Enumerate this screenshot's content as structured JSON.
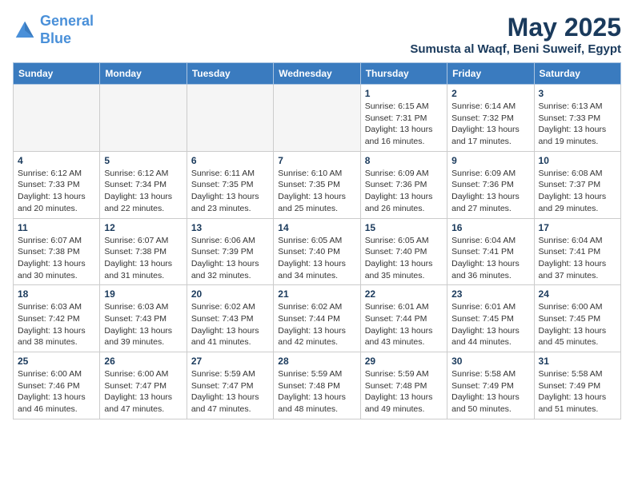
{
  "header": {
    "logo_line1": "General",
    "logo_line2": "Blue",
    "title": "May 2025",
    "subtitle": "Sumusta al Waqf, Beni Suweif, Egypt"
  },
  "weekdays": [
    "Sunday",
    "Monday",
    "Tuesday",
    "Wednesday",
    "Thursday",
    "Friday",
    "Saturday"
  ],
  "weeks": [
    [
      {
        "day": "",
        "info": ""
      },
      {
        "day": "",
        "info": ""
      },
      {
        "day": "",
        "info": ""
      },
      {
        "day": "",
        "info": ""
      },
      {
        "day": "1",
        "info": "Sunrise: 6:15 AM\nSunset: 7:31 PM\nDaylight: 13 hours and 16 minutes."
      },
      {
        "day": "2",
        "info": "Sunrise: 6:14 AM\nSunset: 7:32 PM\nDaylight: 13 hours and 17 minutes."
      },
      {
        "day": "3",
        "info": "Sunrise: 6:13 AM\nSunset: 7:33 PM\nDaylight: 13 hours and 19 minutes."
      }
    ],
    [
      {
        "day": "4",
        "info": "Sunrise: 6:12 AM\nSunset: 7:33 PM\nDaylight: 13 hours and 20 minutes."
      },
      {
        "day": "5",
        "info": "Sunrise: 6:12 AM\nSunset: 7:34 PM\nDaylight: 13 hours and 22 minutes."
      },
      {
        "day": "6",
        "info": "Sunrise: 6:11 AM\nSunset: 7:35 PM\nDaylight: 13 hours and 23 minutes."
      },
      {
        "day": "7",
        "info": "Sunrise: 6:10 AM\nSunset: 7:35 PM\nDaylight: 13 hours and 25 minutes."
      },
      {
        "day": "8",
        "info": "Sunrise: 6:09 AM\nSunset: 7:36 PM\nDaylight: 13 hours and 26 minutes."
      },
      {
        "day": "9",
        "info": "Sunrise: 6:09 AM\nSunset: 7:36 PM\nDaylight: 13 hours and 27 minutes."
      },
      {
        "day": "10",
        "info": "Sunrise: 6:08 AM\nSunset: 7:37 PM\nDaylight: 13 hours and 29 minutes."
      }
    ],
    [
      {
        "day": "11",
        "info": "Sunrise: 6:07 AM\nSunset: 7:38 PM\nDaylight: 13 hours and 30 minutes."
      },
      {
        "day": "12",
        "info": "Sunrise: 6:07 AM\nSunset: 7:38 PM\nDaylight: 13 hours and 31 minutes."
      },
      {
        "day": "13",
        "info": "Sunrise: 6:06 AM\nSunset: 7:39 PM\nDaylight: 13 hours and 32 minutes."
      },
      {
        "day": "14",
        "info": "Sunrise: 6:05 AM\nSunset: 7:40 PM\nDaylight: 13 hours and 34 minutes."
      },
      {
        "day": "15",
        "info": "Sunrise: 6:05 AM\nSunset: 7:40 PM\nDaylight: 13 hours and 35 minutes."
      },
      {
        "day": "16",
        "info": "Sunrise: 6:04 AM\nSunset: 7:41 PM\nDaylight: 13 hours and 36 minutes."
      },
      {
        "day": "17",
        "info": "Sunrise: 6:04 AM\nSunset: 7:41 PM\nDaylight: 13 hours and 37 minutes."
      }
    ],
    [
      {
        "day": "18",
        "info": "Sunrise: 6:03 AM\nSunset: 7:42 PM\nDaylight: 13 hours and 38 minutes."
      },
      {
        "day": "19",
        "info": "Sunrise: 6:03 AM\nSunset: 7:43 PM\nDaylight: 13 hours and 39 minutes."
      },
      {
        "day": "20",
        "info": "Sunrise: 6:02 AM\nSunset: 7:43 PM\nDaylight: 13 hours and 41 minutes."
      },
      {
        "day": "21",
        "info": "Sunrise: 6:02 AM\nSunset: 7:44 PM\nDaylight: 13 hours and 42 minutes."
      },
      {
        "day": "22",
        "info": "Sunrise: 6:01 AM\nSunset: 7:44 PM\nDaylight: 13 hours and 43 minutes."
      },
      {
        "day": "23",
        "info": "Sunrise: 6:01 AM\nSunset: 7:45 PM\nDaylight: 13 hours and 44 minutes."
      },
      {
        "day": "24",
        "info": "Sunrise: 6:00 AM\nSunset: 7:45 PM\nDaylight: 13 hours and 45 minutes."
      }
    ],
    [
      {
        "day": "25",
        "info": "Sunrise: 6:00 AM\nSunset: 7:46 PM\nDaylight: 13 hours and 46 minutes."
      },
      {
        "day": "26",
        "info": "Sunrise: 6:00 AM\nSunset: 7:47 PM\nDaylight: 13 hours and 47 minutes."
      },
      {
        "day": "27",
        "info": "Sunrise: 5:59 AM\nSunset: 7:47 PM\nDaylight: 13 hours and 47 minutes."
      },
      {
        "day": "28",
        "info": "Sunrise: 5:59 AM\nSunset: 7:48 PM\nDaylight: 13 hours and 48 minutes."
      },
      {
        "day": "29",
        "info": "Sunrise: 5:59 AM\nSunset: 7:48 PM\nDaylight: 13 hours and 49 minutes."
      },
      {
        "day": "30",
        "info": "Sunrise: 5:58 AM\nSunset: 7:49 PM\nDaylight: 13 hours and 50 minutes."
      },
      {
        "day": "31",
        "info": "Sunrise: 5:58 AM\nSunset: 7:49 PM\nDaylight: 13 hours and 51 minutes."
      }
    ]
  ]
}
